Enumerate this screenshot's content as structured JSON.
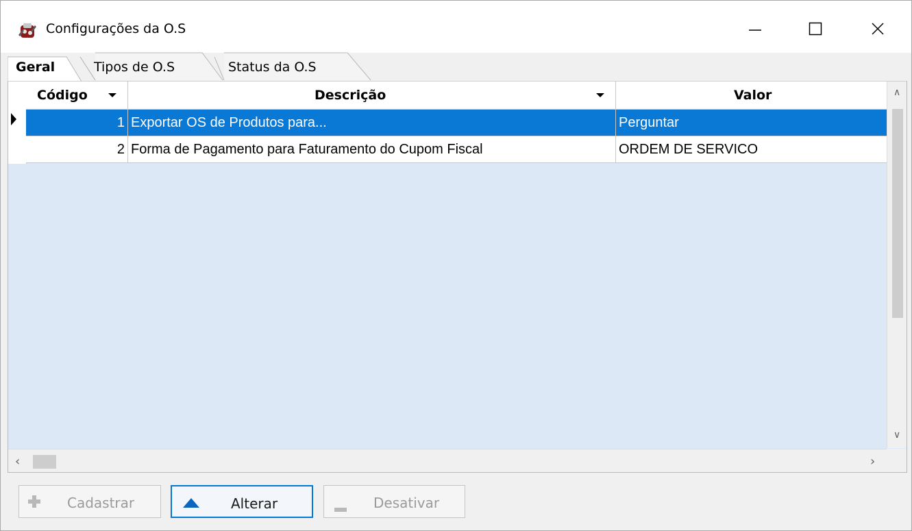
{
  "window": {
    "title": "Configurações da O.S",
    "icon": "app-logo-icon",
    "controls": [
      "minimize-icon",
      "maximize-icon",
      "close-icon"
    ]
  },
  "tabs": [
    {
      "label": "Geral",
      "active": true
    },
    {
      "label": "Tipos de O.S",
      "active": false
    },
    {
      "label": "Status da O.S",
      "active": false
    }
  ],
  "grid": {
    "columns": {
      "codigo": "Código",
      "descricao": "Descrição",
      "valor": "Valor"
    },
    "rows": [
      {
        "codigo": "1",
        "descricao": "Exportar OS de Produtos para...",
        "valor": "Perguntar",
        "selected": true
      },
      {
        "codigo": "2",
        "descricao": "Forma de Pagamento para Faturamento do Cupom Fiscal",
        "valor": "ORDEM DE SERVICO",
        "selected": false
      }
    ]
  },
  "buttons": {
    "cadastrar": "Cadastrar",
    "alterar": "Alterar",
    "desativar": "Desativar"
  },
  "colors": {
    "selection": "#0a79d6",
    "grid_background": "#dde8f6",
    "accent": "#0078d7"
  }
}
